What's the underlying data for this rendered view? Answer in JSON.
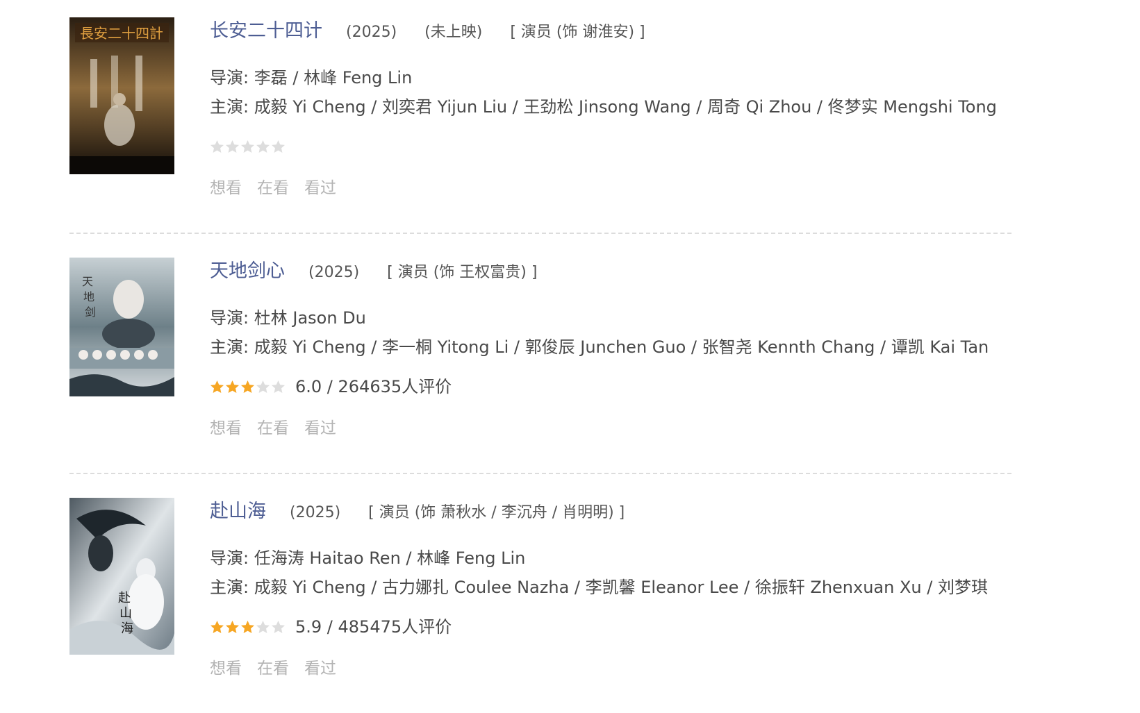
{
  "items": [
    {
      "title": "长安二十四计",
      "year": "(2025)",
      "status": "(未上映)",
      "role": "[ 演员 (饰 谢淮安) ]",
      "director_label": "导演:",
      "director": "李磊 / 林峰 Feng Lin",
      "cast_label": "主演:",
      "cast": "成毅 Yi Cheng / 刘奕君 Yijun Liu / 王劲松 Jinsong Wang / 周奇 Qi Zhou / 佟梦实 Mengshi Tong",
      "rating_stars": 0,
      "rating_text": "",
      "poster_colors": [
        "#1a140e",
        "#8c6a3c"
      ],
      "actions": [
        "想看",
        "在看",
        "看过"
      ]
    },
    {
      "title": "天地剑心",
      "year": "(2025)",
      "status": "",
      "role": "[ 演员 (饰 王权富贵) ]",
      "director_label": "导演:",
      "director": "杜林 Jason Du",
      "cast_label": "主演:",
      "cast": "成毅 Yi Cheng / 李一桐 Yitong Li / 郭俊辰 Junchen Guo / 张智尧 Kennth Chang / 谭凯 Kai Tan",
      "rating_stars": 3,
      "rating_text": "6.0 / 264635人评价",
      "poster_colors": [
        "#b9c4c9",
        "#4e6470"
      ],
      "actions": [
        "想看",
        "在看",
        "看过"
      ]
    },
    {
      "title": "赴山海",
      "year": "(2025)",
      "status": "",
      "role": "[ 演员 (饰 萧秋水 / 李沉舟 / 肖明明) ]",
      "director_label": "导演:",
      "director": "任海涛 Haitao Ren / 林峰 Feng Lin",
      "cast_label": "主演:",
      "cast": "成毅 Yi Cheng / 古力娜扎 Coulee Nazha / 李凯馨 Eleanor Lee / 徐振轩 Zhenxuan Xu / 刘梦琪",
      "rating_stars": 3,
      "rating_text": "5.9 / 485475人评价",
      "poster_colors": [
        "#d9dfe3",
        "#5b6770"
      ],
      "actions": [
        "想看",
        "在看",
        "看过"
      ]
    }
  ],
  "colors": {
    "title": "#4d5d93",
    "star_on": "#f6a623",
    "star_off": "#dddddd",
    "muted": "#b3b3b3"
  }
}
